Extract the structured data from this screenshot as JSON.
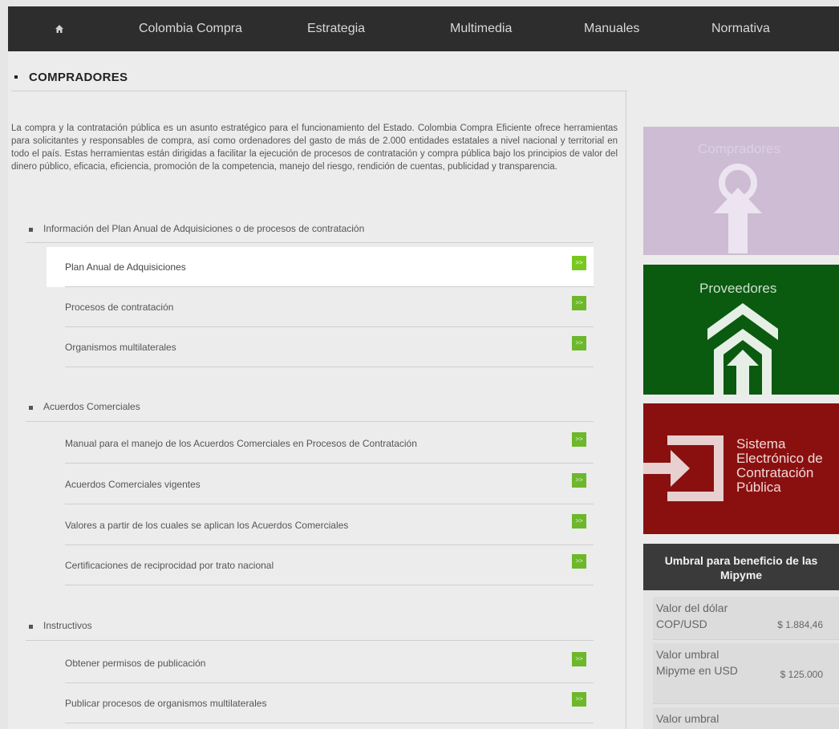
{
  "topnav": {
    "home_icon": "home-icon",
    "items": [
      "Colombia Compra",
      "Estrategia",
      "Multimedia",
      "Manuales",
      "Normativa"
    ]
  },
  "section": {
    "title": "COMPRADORES"
  },
  "intro": "La compra y la contratación pública es un asunto estratégico para el funcionamiento del Estado. Colombia Compra Eficiente ofrece herramientas para solicitantes y responsables de compra, así como ordenadores del gasto de más de 2.000 entidades estatales a nivel nacional y territorial en todo el país. Estas herramientas están dirigidas a facilitar la ejecución de procesos de contratación y compra pública bajo los principios de valor del dinero público, eficacia, eficiencia, promoción de la competencia, manejo del riesgo, rendición de cuentas, publicidad y transparencia.",
  "groups": [
    {
      "title": "Información del Plan Anual de Adquisiciones o de procesos de contratación",
      "links": [
        "Plan Anual de Adquisiciones",
        "Procesos de contratación",
        "Organismos multilaterales"
      ]
    },
    {
      "title": "Acuerdos Comerciales",
      "links": [
        "Manual para el manejo de los Acuerdos Comerciales en Procesos de Contratación",
        "Acuerdos Comerciales vigentes",
        "Valores a partir de los cuales se aplican los Acuerdos Comerciales",
        "Certificaciones de reciprocidad por trato nacional"
      ]
    },
    {
      "title": "Instructivos",
      "links": [
        "Obtener permisos de publicación",
        "Publicar procesos de organismos multilaterales"
      ]
    }
  ],
  "go_label": ">>",
  "tiles": {
    "compradores": "Compradores",
    "proveedores": "Proveedores",
    "secop": "Sistema Electrónico de Contratación Pública"
  },
  "umbral": {
    "title": "Umbral para beneficio de las Mipyme",
    "rows": [
      {
        "label": "Valor del dólar COP/USD",
        "value": "$ 1.884,46"
      },
      {
        "label": "Valor umbral Mipyme en USD",
        "value": "$ 125.000"
      },
      {
        "label": "Valor umbral",
        "value": ""
      }
    ]
  },
  "colors": {
    "nav_bg": "#2d2d2d",
    "go_green": "#6cb82a",
    "tile_compradores": "#cdbcd3",
    "tile_proveedores": "#0a5a10",
    "tile_secop": "#8a1010"
  }
}
